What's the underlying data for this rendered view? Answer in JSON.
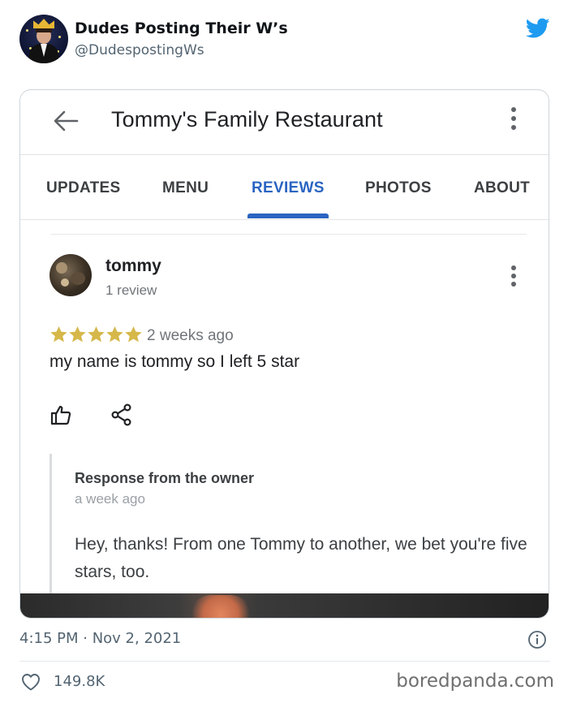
{
  "tweet": {
    "display_name": "Dudes Posting Their W’s",
    "handle": "@DudespostingWs",
    "timestamp": "4:15 PM · Nov 2, 2021",
    "likes": "149.8K",
    "twitter_color": "#1d9bf0"
  },
  "screenshot": {
    "title": "Tommy's Family Restaurant",
    "tabs": [
      {
        "label": "UPDATES",
        "active": false
      },
      {
        "label": "MENU",
        "active": false
      },
      {
        "label": "REVIEWS",
        "active": true
      },
      {
        "label": "PHOTOS",
        "active": false
      },
      {
        "label": "ABOUT",
        "active": false
      }
    ],
    "accent_color": "#2a64c1",
    "review": {
      "reviewer_name": "tommy",
      "reviewer_meta": "1 review",
      "rating": 5,
      "star_color": "#d6b84a",
      "age": "2 weeks ago",
      "text": "my name is tommy so I left 5 star"
    },
    "owner_response": {
      "title": "Response from the owner",
      "age": "a week ago",
      "text": "Hey, thanks! From one Tommy to another, we bet you're five stars, too."
    }
  },
  "watermark": "boredpanda.com"
}
